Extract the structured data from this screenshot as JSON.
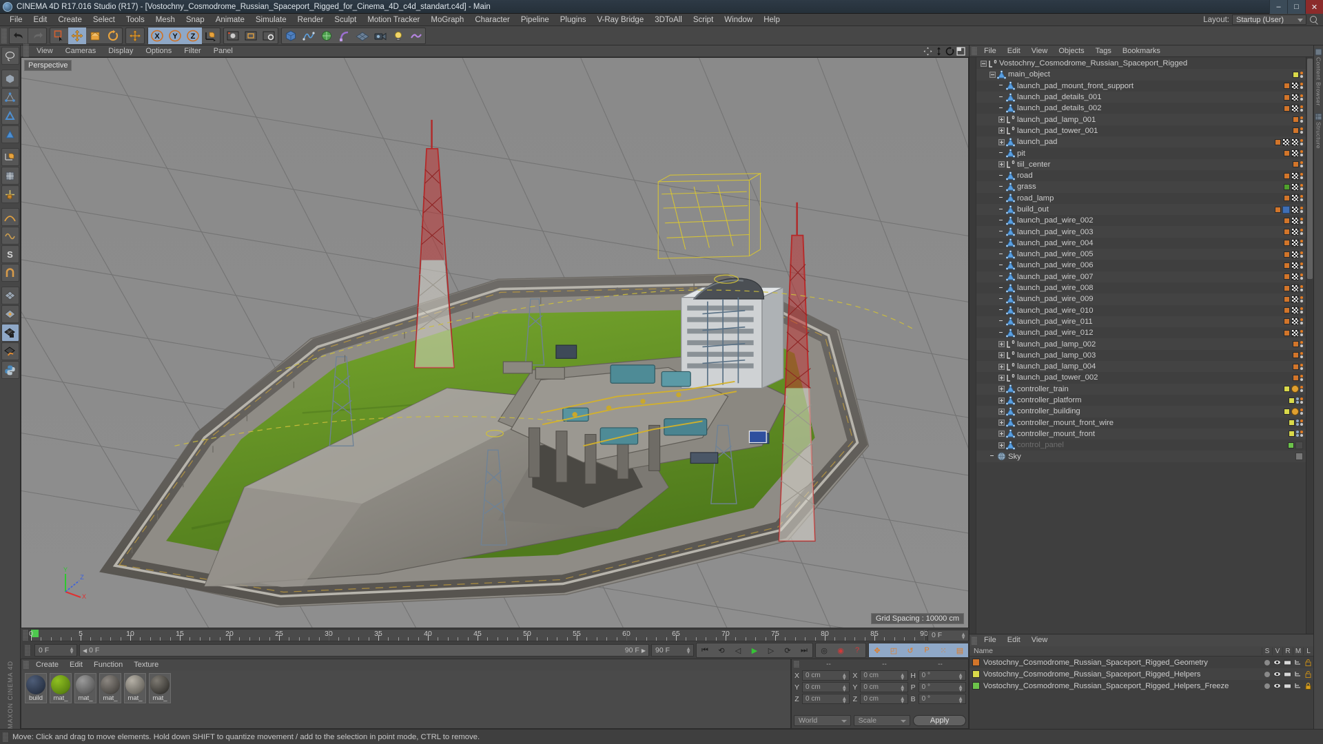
{
  "window": {
    "title": "CINEMA 4D R17.016 Studio (R17) - [Vostochny_Cosmodrome_Russian_Spaceport_Rigged_for_Cinema_4D_c4d_standart.c4d] - Main",
    "minimize": "–",
    "maximize": "□",
    "close": "✕"
  },
  "menubar": {
    "items": [
      "File",
      "Edit",
      "Create",
      "Select",
      "Tools",
      "Mesh",
      "Snap",
      "Animate",
      "Simulate",
      "Render",
      "Sculpt",
      "Motion Tracker",
      "MoGraph",
      "Character",
      "Pipeline",
      "Plugins",
      "V-Ray Bridge",
      "3DToAll",
      "Script",
      "Window",
      "Help"
    ],
    "layout_label": "Layout:",
    "layout_value": "Startup (User)",
    "search_icon": "search-icon"
  },
  "toolbar": {
    "buttons": [
      {
        "name": "undo-button",
        "icon": "undo-arrow-icon",
        "active": false
      },
      {
        "name": "redo-button",
        "icon": "redo-arrow-icon",
        "active": false
      },
      {
        "name": "live-selection-button",
        "icon": "selection-square-icon",
        "active": false
      },
      {
        "name": "move-tool-button",
        "icon": "move-cross-icon",
        "active": true
      },
      {
        "name": "scale-tool-button",
        "icon": "scale-box-icon",
        "active": false
      },
      {
        "name": "rotate-tool-button",
        "icon": "rotate-circle-icon",
        "active": false
      },
      {
        "name": "move-alt-button",
        "icon": "move-cross-icon",
        "active": false
      },
      {
        "name": "x-axis-toggle",
        "icon": "x-axis-icon",
        "active": true,
        "label": "X"
      },
      {
        "name": "y-axis-toggle",
        "icon": "y-axis-icon",
        "active": true,
        "label": "Y"
      },
      {
        "name": "z-axis-toggle",
        "icon": "z-axis-icon",
        "active": true,
        "label": "Z"
      },
      {
        "name": "world-coord-toggle",
        "icon": "world-cube-icon",
        "active": false
      },
      {
        "name": "render-view-button",
        "icon": "render-frame-icon",
        "active": false
      },
      {
        "name": "render-region-button",
        "icon": "render-region-icon",
        "active": false
      },
      {
        "name": "render-settings-button",
        "icon": "render-settings-icon",
        "active": false
      },
      {
        "name": "add-cube-button",
        "icon": "cube-primitive-icon",
        "active": false
      },
      {
        "name": "add-spline-button",
        "icon": "spline-pen-icon",
        "active": false
      },
      {
        "name": "generator-button",
        "icon": "generator-icon",
        "active": false
      },
      {
        "name": "bend-deformer-button",
        "icon": "deformer-icon",
        "active": false
      },
      {
        "name": "environment-button",
        "icon": "floor-env-icon",
        "active": false
      },
      {
        "name": "camera-button",
        "icon": "camera-icon",
        "active": false
      },
      {
        "name": "light-button",
        "icon": "light-bulb-icon",
        "active": false
      },
      {
        "name": "deformer-extra-button",
        "icon": "deformer-wave-icon",
        "active": false
      }
    ]
  },
  "left_tools": [
    {
      "name": "lasso-select-tool",
      "icon": "lasso-icon"
    },
    {
      "name": "box-model-tool",
      "icon": "box-icon"
    },
    {
      "name": "points-mode-tool",
      "icon": "points-icon"
    },
    {
      "name": "edges-mode-tool",
      "icon": "edges-icon"
    },
    {
      "name": "polygons-mode-tool",
      "icon": "polygons-icon"
    },
    {
      "name": "model-mode-tool",
      "icon": "model-cube-icon"
    },
    {
      "name": "texture-axis-tool",
      "icon": "texture-axis-icon"
    },
    {
      "name": "enable-axis-tool",
      "icon": "axis-lock-icon"
    },
    {
      "name": "soft-selection-tool",
      "icon": "soft-select-icon"
    },
    {
      "name": "animate-mode-tool",
      "icon": "animate-icon"
    },
    {
      "name": "viewport-solo-tool",
      "icon": "solo-icon"
    },
    {
      "name": "snap-tool",
      "icon": "magnet-icon"
    },
    {
      "name": "workplane-lock-tool",
      "icon": "workplane-lock-icon",
      "active": true
    },
    {
      "name": "workplane-tool",
      "icon": "workplane-icon"
    },
    {
      "name": "python-tool",
      "icon": "python-icon"
    }
  ],
  "viewport": {
    "menus": [
      "View",
      "Cameras",
      "Display",
      "Options",
      "Filter",
      "Panel"
    ],
    "perspective_label": "Perspective",
    "grid_spacing": "Grid Spacing : 10000 cm",
    "axis_labels": {
      "x": "X",
      "y": "Y",
      "z": "Z"
    },
    "nav_icons": [
      "pan-icon",
      "zoom-icon",
      "rotate-icon",
      "maximize-view-icon"
    ]
  },
  "timeline": {
    "frame_labels": [
      "0",
      "5",
      "10",
      "15",
      "20",
      "25",
      "30",
      "35",
      "40",
      "45",
      "50",
      "55",
      "60",
      "65",
      "70",
      "75",
      "80",
      "85",
      "90"
    ],
    "start_frame": "0 F",
    "end_frame": "90 F",
    "current_frame": "0 F",
    "preview_start": "0 F",
    "preview_end": "90 F",
    "min_frame": 0,
    "max_frame": 90,
    "playhead_frame": 0
  },
  "playback": {
    "buttons": [
      {
        "name": "go-to-start-button",
        "glyph": "⏮"
      },
      {
        "name": "play-reverse-button",
        "glyph": "⟲"
      },
      {
        "name": "previous-frame-button",
        "glyph": "◁"
      },
      {
        "name": "play-forward-button",
        "glyph": "▶"
      },
      {
        "name": "next-frame-button",
        "glyph": "▷"
      },
      {
        "name": "loop-button",
        "glyph": "⟳"
      },
      {
        "name": "go-to-end-button",
        "glyph": "⏭"
      }
    ],
    "record_buttons": [
      {
        "name": "autokey-button",
        "glyph": "◎"
      },
      {
        "name": "record-active-objects-button",
        "glyph": "◉"
      },
      {
        "name": "keyframe-selection-button",
        "glyph": "?"
      }
    ],
    "param_buttons": [
      {
        "name": "record-position-button",
        "glyph": "✥"
      },
      {
        "name": "record-scale-button",
        "glyph": "◰"
      },
      {
        "name": "record-rotation-button",
        "glyph": "↺"
      },
      {
        "name": "record-pla-button",
        "glyph": "P"
      },
      {
        "name": "record-points-button",
        "glyph": "⁙"
      },
      {
        "name": "timeline-view-button",
        "glyph": "▤"
      }
    ]
  },
  "materials": {
    "menus": [
      "Create",
      "Edit",
      "Function",
      "Texture"
    ],
    "items": [
      {
        "name": "build",
        "color1": "#4e5d78",
        "color2": "#2a3446"
      },
      {
        "name": "mat_",
        "color1": "#8fc021",
        "color2": "#5c8512"
      },
      {
        "name": "mat_",
        "color1": "#9a9a9a",
        "color2": "#5e5e5e"
      },
      {
        "name": "mat_",
        "color1": "#8c8781",
        "color2": "#4d4a46"
      },
      {
        "name": "mat_",
        "color1": "#b5b0a6",
        "color2": "#6d6a63"
      },
      {
        "name": "mat_",
        "color1": "#7e7a72",
        "color2": "#3c3a36"
      }
    ]
  },
  "coordinates": {
    "headers": [
      "--",
      "--",
      "--"
    ],
    "position": {
      "labels": [
        "X",
        "Y",
        "Z"
      ],
      "values": [
        "0 cm",
        "0 cm",
        "0 cm"
      ]
    },
    "size": {
      "labels": [
        "X",
        "Y",
        "Z"
      ],
      "values": [
        "0 cm",
        "0 cm",
        "0 cm"
      ]
    },
    "rotation": {
      "labels": [
        "H",
        "P",
        "B"
      ],
      "values": [
        "0 °",
        "0 °",
        "0 °"
      ]
    },
    "coord_system": "World",
    "size_mode": "Scale",
    "apply_label": "Apply"
  },
  "object_manager": {
    "menus": [
      "File",
      "Edit",
      "View",
      "Objects",
      "Tags",
      "Bookmarks"
    ],
    "items": [
      {
        "label": "Vostochny_Cosmodrome_Russian_Spaceport_Rigged",
        "depth": 0,
        "icon": "null-object-icon",
        "expand": "minus",
        "swatch": null,
        "tags": []
      },
      {
        "label": "main_object",
        "depth": 1,
        "icon": "polygon-object-icon",
        "expand": "minus",
        "swatch": "#d9d94a",
        "tags": [
          "dots"
        ]
      },
      {
        "label": "launch_pad_mount_front_support",
        "depth": 2,
        "icon": "polygon-object-icon",
        "expand": "none",
        "swatch": "#d2752a",
        "tags": [
          "checker",
          "dots"
        ]
      },
      {
        "label": "launch_pad_details_001",
        "depth": 2,
        "icon": "polygon-object-icon",
        "expand": "none",
        "swatch": "#d2752a",
        "tags": [
          "checker",
          "dots"
        ]
      },
      {
        "label": "launch_pad_details_002",
        "depth": 2,
        "icon": "polygon-object-icon",
        "expand": "none",
        "swatch": "#d2752a",
        "tags": [
          "checker",
          "dots"
        ]
      },
      {
        "label": "launch_pad_lamp_001",
        "depth": 2,
        "icon": "null-object-icon",
        "expand": "plus",
        "swatch": "#d2752a",
        "tags": [
          "dots"
        ]
      },
      {
        "label": "launch_pad_tower_001",
        "depth": 2,
        "icon": "null-object-icon",
        "expand": "plus",
        "swatch": "#d2752a",
        "tags": [
          "dots"
        ]
      },
      {
        "label": "launch_pad",
        "depth": 2,
        "icon": "polygon-object-icon",
        "expand": "plus",
        "swatch": "#d2752a",
        "tags": [
          "checker",
          "checker2",
          "dots"
        ]
      },
      {
        "label": "pit",
        "depth": 2,
        "icon": "polygon-object-icon",
        "expand": "none",
        "swatch": "#d2752a",
        "tags": [
          "checker",
          "dots"
        ]
      },
      {
        "label": "tiil_center",
        "depth": 2,
        "icon": "null-object-icon",
        "expand": "plus",
        "swatch": "#d2752a",
        "tags": [
          "dots"
        ]
      },
      {
        "label": "road",
        "depth": 2,
        "icon": "polygon-object-icon",
        "expand": "none",
        "swatch": "#d2752a",
        "tags": [
          "checker",
          "dots"
        ]
      },
      {
        "label": "grass",
        "depth": 2,
        "icon": "polygon-object-icon",
        "expand": "none",
        "swatch": "#4fa02c",
        "tags": [
          "checker",
          "dots"
        ]
      },
      {
        "label": "road_lamp",
        "depth": 2,
        "icon": "polygon-object-icon",
        "expand": "none",
        "swatch": "#d2752a",
        "tags": [
          "checker",
          "dots"
        ]
      },
      {
        "label": "build_out",
        "depth": 2,
        "icon": "polygon-object-icon",
        "expand": "none",
        "swatch": "#d2752a",
        "tags": [
          "blue",
          "checker",
          "dots"
        ]
      },
      {
        "label": "launch_pad_wire_002",
        "depth": 2,
        "icon": "polygon-object-icon",
        "expand": "none",
        "swatch": "#d2752a",
        "tags": [
          "checker",
          "dots"
        ]
      },
      {
        "label": "launch_pad_wire_003",
        "depth": 2,
        "icon": "polygon-object-icon",
        "expand": "none",
        "swatch": "#d2752a",
        "tags": [
          "checker",
          "dots"
        ]
      },
      {
        "label": "launch_pad_wire_004",
        "depth": 2,
        "icon": "polygon-object-icon",
        "expand": "none",
        "swatch": "#d2752a",
        "tags": [
          "checker",
          "dots"
        ]
      },
      {
        "label": "launch_pad_wire_005",
        "depth": 2,
        "icon": "polygon-object-icon",
        "expand": "none",
        "swatch": "#d2752a",
        "tags": [
          "checker",
          "dots"
        ]
      },
      {
        "label": "launch_pad_wire_006",
        "depth": 2,
        "icon": "polygon-object-icon",
        "expand": "none",
        "swatch": "#d2752a",
        "tags": [
          "checker",
          "dots"
        ]
      },
      {
        "label": "launch_pad_wire_007",
        "depth": 2,
        "icon": "polygon-object-icon",
        "expand": "none",
        "swatch": "#d2752a",
        "tags": [
          "checker",
          "dots"
        ]
      },
      {
        "label": "launch_pad_wire_008",
        "depth": 2,
        "icon": "polygon-object-icon",
        "expand": "none",
        "swatch": "#d2752a",
        "tags": [
          "checker",
          "dots"
        ]
      },
      {
        "label": "launch_pad_wire_009",
        "depth": 2,
        "icon": "polygon-object-icon",
        "expand": "none",
        "swatch": "#d2752a",
        "tags": [
          "checker",
          "dots"
        ]
      },
      {
        "label": "launch_pad_wire_010",
        "depth": 2,
        "icon": "polygon-object-icon",
        "expand": "none",
        "swatch": "#d2752a",
        "tags": [
          "checker",
          "dots"
        ]
      },
      {
        "label": "launch_pad_wire_011",
        "depth": 2,
        "icon": "polygon-object-icon",
        "expand": "none",
        "swatch": "#d2752a",
        "tags": [
          "checker",
          "dots"
        ]
      },
      {
        "label": "launch_pad_wire_012",
        "depth": 2,
        "icon": "polygon-object-icon",
        "expand": "none",
        "swatch": "#d2752a",
        "tags": [
          "checker",
          "dots"
        ]
      },
      {
        "label": "launch_pad_lamp_002",
        "depth": 2,
        "icon": "null-object-icon",
        "expand": "plus",
        "swatch": "#d2752a",
        "tags": [
          "dots"
        ]
      },
      {
        "label": "launch_pad_lamp_003",
        "depth": 2,
        "icon": "null-object-icon",
        "expand": "plus",
        "swatch": "#d2752a",
        "tags": [
          "dots"
        ]
      },
      {
        "label": "launch_pad_lamp_004",
        "depth": 2,
        "icon": "null-object-icon",
        "expand": "plus",
        "swatch": "#d2752a",
        "tags": [
          "dots"
        ]
      },
      {
        "label": "launch_pad_tower_002",
        "depth": 2,
        "icon": "null-object-icon",
        "expand": "plus",
        "swatch": "#d2752a",
        "tags": [
          "dots"
        ]
      },
      {
        "label": "controller_train",
        "depth": 2,
        "icon": "polygon-object-icon",
        "expand": "plus",
        "swatch": "#d9d94a",
        "tags": [
          "protect",
          "dots"
        ]
      },
      {
        "label": "controller_platform",
        "depth": 2,
        "icon": "polygon-object-icon",
        "expand": "plus",
        "swatch": "#d9d94a",
        "tags": [
          "dots2",
          "dots"
        ]
      },
      {
        "label": "controller_building",
        "depth": 2,
        "icon": "polygon-object-icon",
        "expand": "plus",
        "swatch": "#d9d94a",
        "tags": [
          "protect",
          "dots"
        ]
      },
      {
        "label": "controller_mount_front_wire",
        "depth": 2,
        "icon": "polygon-object-icon",
        "expand": "plus",
        "swatch": "#d9d94a",
        "tags": [
          "dots2",
          "dots"
        ]
      },
      {
        "label": "controller_mount_front",
        "depth": 2,
        "icon": "polygon-object-icon",
        "expand": "plus",
        "swatch": "#d9d94a",
        "tags": [
          "dots2",
          "dots"
        ]
      },
      {
        "label": "control_panel",
        "depth": 2,
        "icon": "polygon-object-icon",
        "expand": "plus",
        "swatch": "#6cc24a",
        "tags": [
          "dim"
        ],
        "dim": true
      },
      {
        "label": "Sky",
        "depth": 1,
        "icon": "sky-object-icon",
        "expand": "none",
        "swatch": null,
        "tags": [
          "sky"
        ]
      }
    ]
  },
  "layer_manager": {
    "menus": [
      "File",
      "Edit",
      "View"
    ],
    "name_header": "Name",
    "columns": [
      "S",
      "V",
      "R",
      "M",
      "L"
    ],
    "rows": [
      {
        "color": "#d2752a",
        "name": "Vostochny_Cosmodrome_Russian_Spaceport_Rigged_Geometry",
        "locked": false
      },
      {
        "color": "#d9d94a",
        "name": "Vostochny_Cosmodrome_Russian_Spaceport_Rigged_Helpers",
        "locked": false
      },
      {
        "color": "#6cc24a",
        "name": "Vostochny_Cosmodrome_Russian_Spaceport_Rigged_Helpers_Freeze",
        "locked": true
      }
    ]
  },
  "edge_strip": {
    "labels": [
      "Content Browser",
      "Structure"
    ]
  },
  "statusbar": {
    "message": "Move: Click and drag to move elements. Hold down SHIFT to quantize movement / add to the selection in point mode, CTRL to remove."
  },
  "brand": "MAXON CINEMA 4D"
}
